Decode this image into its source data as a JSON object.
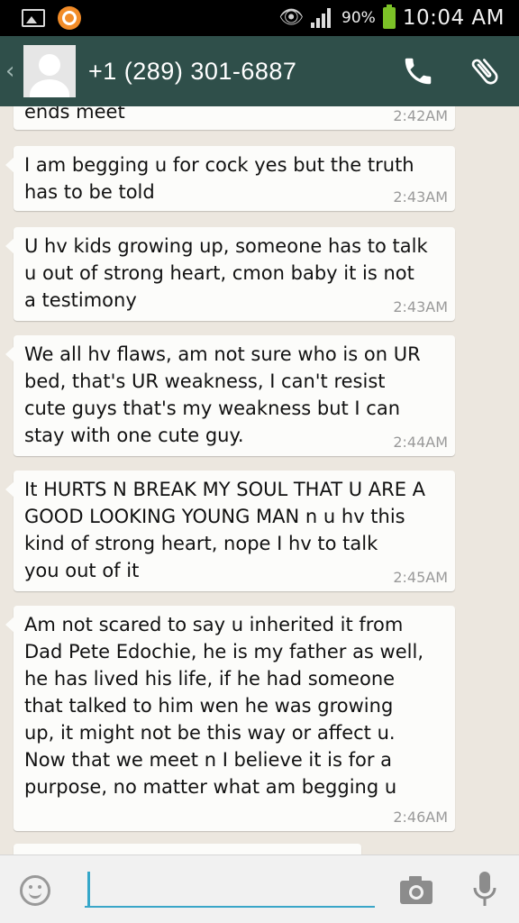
{
  "status_bar": {
    "battery_percent": "90%",
    "time": "10:04 AM"
  },
  "header": {
    "contact": "+1 (289) 301-6887",
    "back_icon": "chevron-left-icon",
    "call_icon": "phone-icon",
    "attach_icon": "paperclip-icon"
  },
  "messages": [
    {
      "text": "ends meet",
      "time": "2:42AM"
    },
    {
      "text": "I am begging u for cock yes but the truth\nhas to be told",
      "time": "2:43AM"
    },
    {
      "text": "U hv kids growing up, someone has to talk\nu out of strong heart, cmon baby it is not\na testimony",
      "time": "2:43AM"
    },
    {
      "text": "We all hv flaws, am not sure who is on UR\nbed, that's UR weakness, I can't resist\ncute guys that's my weakness but I can\nstay with one cute guy.",
      "time": "2:44AM"
    },
    {
      "text": "It HURTS N BREAK MY SOUL THAT U ARE A\nGOOD LOOKING YOUNG MAN n u hv this\nkind of strong heart, nope I hv to talk\nyou out of it",
      "time": "2:45AM"
    },
    {
      "text": "Am not scared to say u inherited it from\nDad Pete Edochie, he is my father as well,\nhe has lived his life, if he had someone\nthat talked to him wen he was growing\nup, it might not be this way or affect u.\nNow that we meet n I believe it is for a\npurpose, no matter what am begging u",
      "time": "2:46AM"
    }
  ],
  "input": {
    "placeholder": "",
    "value": ""
  },
  "colors": {
    "header_bg": "#2f4f4a",
    "chat_bg": "#ece7df",
    "bubble_bg": "#fcfcfa",
    "accent": "#35a7c9",
    "battery": "#7cc227"
  }
}
